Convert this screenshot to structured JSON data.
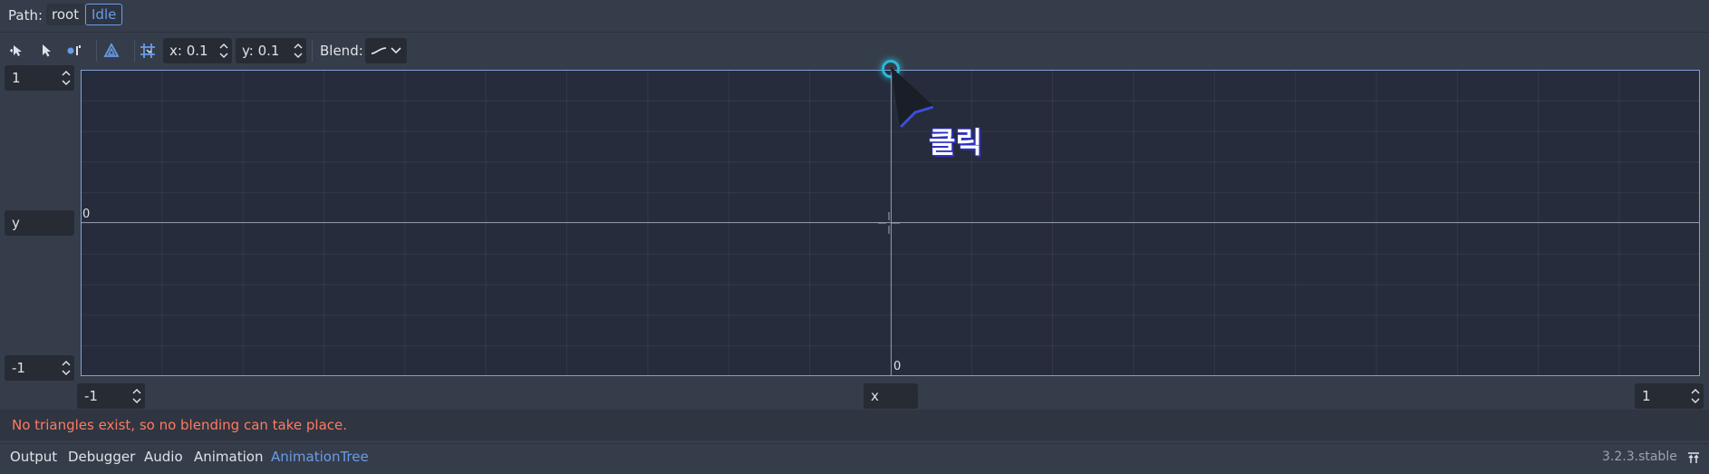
{
  "path": {
    "label": "Path:",
    "crumbs": [
      "root",
      "Idle"
    ]
  },
  "toolbar": {
    "snap_x": "x: 0.1",
    "snap_y": "y: 0.1",
    "blend_label": "Blend:",
    "icons": [
      "create-points-icon",
      "select-icon",
      "create-triangles-icon",
      "erase-icon",
      "snap-icon"
    ]
  },
  "axes": {
    "y_max": "1",
    "y_label": "y",
    "y_min": "-1",
    "x_min": "-1",
    "x_label": "x",
    "x_max": "1",
    "origin_y_label": "0",
    "origin_x_label": "0"
  },
  "status": {
    "message": "No triangles exist, so no blending can take place."
  },
  "bottom_tabs": [
    "Output",
    "Debugger",
    "Audio",
    "Animation",
    "AnimationTree"
  ],
  "active_tab": "AnimationTree",
  "version": "3.2.3.stable",
  "annotation": {
    "click_text": "클릭"
  },
  "colors": {
    "accent": "#699ce8",
    "error": "#ff7a61",
    "background": "#363d4a"
  }
}
